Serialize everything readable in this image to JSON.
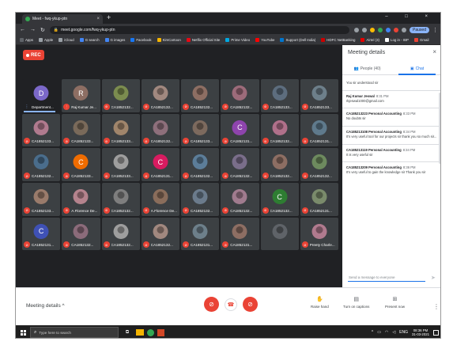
{
  "browser": {
    "tab_title": "Meet - fwq-ykup-ptn",
    "tab_close": "×",
    "new_tab": "+",
    "window_controls": "–  □  ×",
    "url": "meet.google.com/fwq-ykup-ptn",
    "profile_label": "Paused",
    "bookmarks": [
      {
        "label": "Apps",
        "color": "#5f6368"
      },
      {
        "label": "Apple",
        "color": "#9aa0a6"
      },
      {
        "label": "iCloud",
        "color": "#9aa0a6"
      },
      {
        "label": "G search",
        "color": "#4285f4"
      },
      {
        "label": "G images",
        "color": "#4285f4"
      },
      {
        "label": "Facebook",
        "color": "#1877f2"
      },
      {
        "label": "KimCartoon",
        "color": "#f4b400"
      },
      {
        "label": "Netflix Official Site",
        "color": "#e50914"
      },
      {
        "label": "Prime Video",
        "color": "#00a8e1"
      },
      {
        "label": "YouTube",
        "color": "#ff0000"
      },
      {
        "label": "Support (Dell India)",
        "color": "#0076ce"
      },
      {
        "label": "HDFC NetBanking",
        "color": "#c00"
      },
      {
        "label": "Airtel (3)",
        "color": "#e40000"
      },
      {
        "label": "Log in - IBP",
        "color": "#fff"
      },
      {
        "label": "Gmail",
        "color": "#ea4335"
      }
    ]
  },
  "meet": {
    "rec_label": "REC",
    "participants": [
      {
        "name": "Department...",
        "initial": "D",
        "color": "#7b68c9",
        "mic": "live"
      },
      {
        "name": "Raj Kumar Je...",
        "initial": "R",
        "color": "#8d6e63",
        "mic": "live"
      },
      {
        "name": "CA1852132...",
        "initial": "",
        "color": "#7b8c4f",
        "mic": "muted"
      },
      {
        "name": "CA1852132...",
        "initial": "",
        "color": "#a1887f",
        "mic": "muted"
      },
      {
        "name": "CA1852132...",
        "initial": "",
        "color": "#8d6e63",
        "mic": "muted"
      },
      {
        "name": "CA1852132...",
        "initial": "",
        "color": "#9c6b7a",
        "mic": "muted"
      },
      {
        "name": "CA1852133...",
        "initial": "",
        "color": "#5d6d7e",
        "mic": "muted"
      },
      {
        "name": "CA1852133...",
        "initial": "",
        "color": "#6d7f8a",
        "mic": "muted"
      },
      {
        "name": "CA1852133...",
        "initial": "",
        "color": "#b07a8e",
        "mic": "muted"
      },
      {
        "name": "CA1852133...",
        "initial": "",
        "color": "#7a6a5a",
        "mic": "muted"
      },
      {
        "name": "CA1852133...",
        "initial": "",
        "color": "#a0856b",
        "mic": "muted"
      },
      {
        "name": "CA1852132...",
        "initial": "",
        "color": "#8e6f7b",
        "mic": "muted"
      },
      {
        "name": "CA1852133...",
        "initial": "",
        "color": "#7d6a5e",
        "mic": "muted"
      },
      {
        "name": "CA1852131...",
        "initial": "C",
        "color": "#8e44ad",
        "mic": "muted"
      },
      {
        "name": "CA1852132...",
        "initial": "",
        "color": "#b0708a",
        "mic": "muted"
      },
      {
        "name": "CA1852131...",
        "initial": "",
        "color": "#5f7a8c",
        "mic": "muted"
      },
      {
        "name": "CA1852132...",
        "initial": "",
        "color": "#4a6d8c",
        "mic": "muted"
      },
      {
        "name": "CA1852133...",
        "initial": "C",
        "color": "#ef6c00",
        "mic": "muted"
      },
      {
        "name": "CA1852133...",
        "initial": "",
        "color": "#9e9e9e",
        "mic": "muted"
      },
      {
        "name": "CA1852131...",
        "initial": "C",
        "color": "#d81b60",
        "mic": "muted"
      },
      {
        "name": "CA1852132...",
        "initial": "",
        "color": "#5c7d99",
        "mic": "muted"
      },
      {
        "name": "CA1852132...",
        "initial": "",
        "color": "#7a6e8a",
        "mic": "muted"
      },
      {
        "name": "CA1852132...",
        "initial": "",
        "color": "#8d6e63",
        "mic": "muted"
      },
      {
        "name": "CA1852132...",
        "initial": "",
        "color": "#6d8a5e",
        "mic": "muted"
      },
      {
        "name": "CA1852133...",
        "initial": "",
        "color": "#9a7b6b",
        "mic": "muted"
      },
      {
        "name": "A.Florence De...",
        "initial": "",
        "color": "#b5838d",
        "mic": "muted"
      },
      {
        "name": "CA1852132...",
        "initial": "",
        "color": "#7e7e7e",
        "mic": "muted"
      },
      {
        "name": "A.Florence De...",
        "initial": "",
        "color": "#8a6d5b",
        "mic": "muted"
      },
      {
        "name": "CA1852132...",
        "initial": "",
        "color": "#6b7b8c",
        "mic": "muted"
      },
      {
        "name": "CA1852132...",
        "initial": "",
        "color": "#a07b8e",
        "mic": "muted"
      },
      {
        "name": "CA1852132...",
        "initial": "C",
        "color": "#2e7d32",
        "mic": "muted"
      },
      {
        "name": "CA1852131...",
        "initial": "",
        "color": "#7a8b6b",
        "mic": "muted"
      },
      {
        "name": "CA1852131...",
        "initial": "C",
        "color": "#3f51b5",
        "mic": "muted"
      },
      {
        "name": "CA1852132...",
        "initial": "",
        "color": "#8b6b7a",
        "mic": "muted"
      },
      {
        "name": "CA1852132...",
        "initial": "",
        "color": "#9e9e9e",
        "mic": "muted"
      },
      {
        "name": "CA1852132...",
        "initial": "",
        "color": "#a1887f",
        "mic": "muted"
      },
      {
        "name": "CA1852131...",
        "initial": "",
        "color": "#6d7f8a",
        "mic": "muted"
      },
      {
        "name": "CA1852131...",
        "initial": "",
        "color": "#8d6e63",
        "mic": "muted"
      },
      {
        "name": "",
        "initial": "",
        "color": "#5f6368",
        "mic": "muted"
      },
      {
        "name": "Preety Charle...",
        "initial": "",
        "color": "#b07a8e",
        "mic": "muted"
      }
    ]
  },
  "panel": {
    "title": "Meeting details",
    "close": "×",
    "tab_people": "People (40)",
    "tab_chat": "Chat",
    "messages": [
      {
        "sender": "",
        "time": "",
        "text": "You sir understood sir"
      },
      {
        "sender": "Raj Kumar Jeswal",
        "time": "8:31 PM",
        "text": "rkjeswal1000@gmail.com"
      },
      {
        "sender": "CA185213223 Personal Accounting",
        "time": "8:33 PM",
        "text": "No doubts sir"
      },
      {
        "sender": "CA185213108 Personal Accounting",
        "time": "8:34 PM",
        "text": "It's very useful tool for our projects sir thank you so much sir..."
      },
      {
        "sender": "CA185213119 Personal Accounting",
        "time": "8:34 PM",
        "text": "It is very useful sir"
      },
      {
        "sender": "CA185213209 Personal Accounting",
        "time": "8:36 PM",
        "text": "It's very useful to gain the knowledge sir Thank you sir"
      }
    ],
    "input_placeholder": "Send a message to everyone",
    "send": "➤"
  },
  "bottom": {
    "meeting_details": "Meeting details ^",
    "raise_hand": "Raise hand",
    "captions": "Turn on captions",
    "present": "Present now",
    "more": "⋮"
  },
  "taskbar": {
    "search_placeholder": "Type here to search",
    "time": "08:36 PM",
    "date": "31-03-2021",
    "lang": "ENG"
  }
}
